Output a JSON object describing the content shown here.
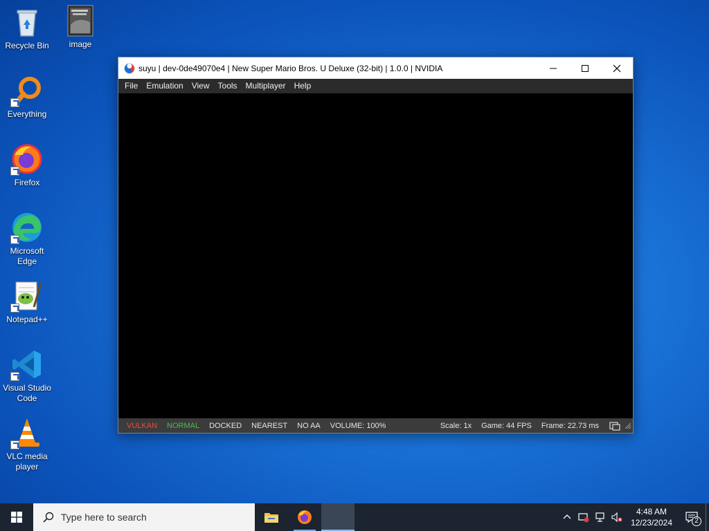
{
  "desktop": {
    "icons": [
      {
        "label": "Recycle Bin"
      },
      {
        "label": "image"
      },
      {
        "label": "Everything"
      },
      {
        "label": "Firefox"
      },
      {
        "label": "Microsoft Edge"
      },
      {
        "label": "Notepad++"
      },
      {
        "label": "Visual Studio Code"
      },
      {
        "label": "VLC media player"
      }
    ]
  },
  "window": {
    "title": "suyu | dev-0de49070e4 | New Super Mario Bros. U Deluxe (32-bit) | 1.0.0 | NVIDIA",
    "menu": [
      "File",
      "Emulation",
      "View",
      "Tools",
      "Multiplayer",
      "Help"
    ],
    "status": {
      "api": "VULKAN",
      "mode": "NORMAL",
      "dock": "DOCKED",
      "filter": "NEAREST",
      "aa": "NO AA",
      "volume": "VOLUME: 100%",
      "scale": "Scale: 1x",
      "fps": "Game: 44 FPS",
      "frame": "Frame: 22.73 ms"
    }
  },
  "taskbar": {
    "search_placeholder": "Type here to search",
    "time": "4:48 AM",
    "date": "12/23/2024",
    "notification_count": "2"
  },
  "colors": {
    "status_red": "#e6503a",
    "status_green": "#45c04a",
    "taskbar_bg": "#1b2430"
  }
}
